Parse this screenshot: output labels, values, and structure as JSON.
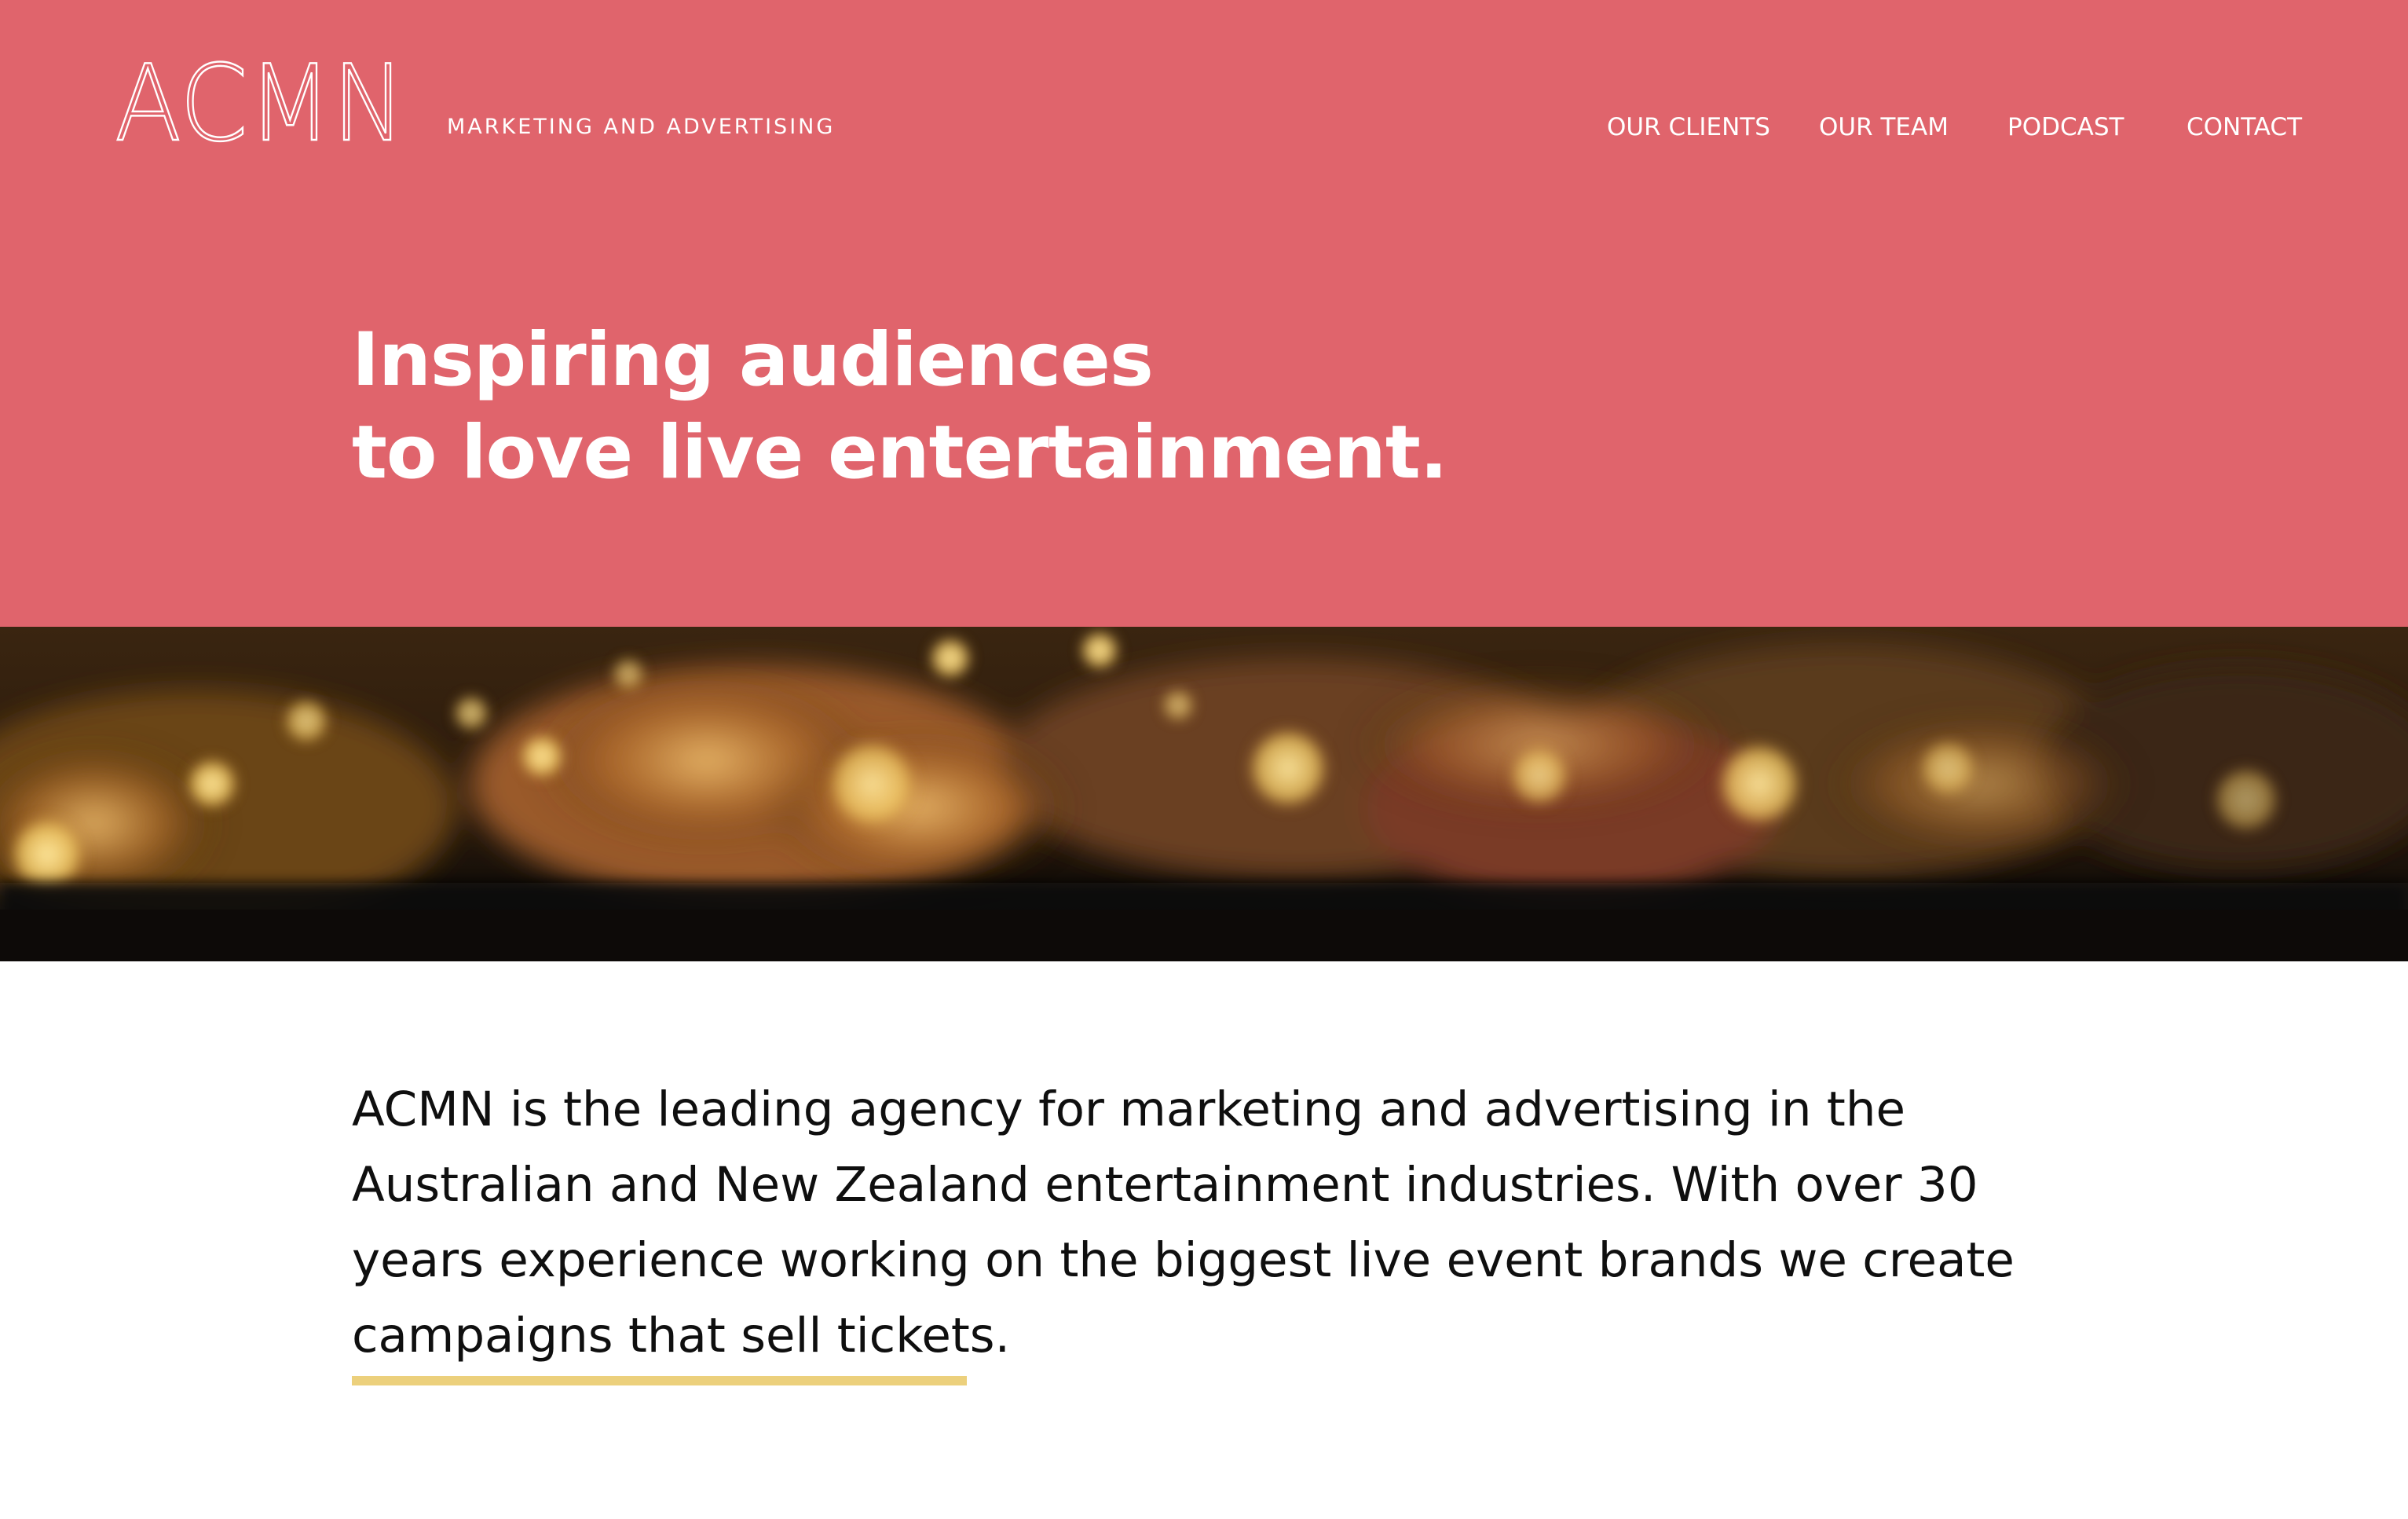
{
  "brand": {
    "logo_text": "ACMN",
    "tagline": "MARKETING AND ADVERTISING"
  },
  "nav": {
    "clients": "OUR CLIENTS",
    "team": "OUR TEAM",
    "podcast": "PODCAST",
    "contact": "CONTACT"
  },
  "hero": {
    "headline_line1": "Inspiring audiences",
    "headline_line2": "to love live entertainment."
  },
  "intro": {
    "line1": "ACMN is the leading agency for marketing and advertising in the",
    "line2": "Australian and New Zealand entertainment industries. With over 30",
    "line3": "years experience working on the biggest live event brands we create",
    "line4": "campaigns that sell tickets."
  },
  "colors": {
    "hero_background": "#e0646c",
    "accent_underline": "#ecd07c",
    "text_dark": "#0f0f0f",
    "text_light": "#ffffff"
  }
}
